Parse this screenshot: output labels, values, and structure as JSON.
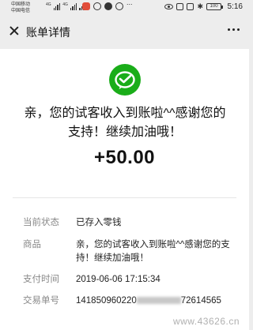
{
  "status_bar": {
    "carrier_1": "中国移动",
    "carrier_2": "中国电信",
    "net_1": "4G",
    "net_2": "4G",
    "battery": "100",
    "time": "5:16"
  },
  "nav": {
    "title": "账单详情"
  },
  "bill": {
    "memo": "亲，您的试客收入到账啦^^感谢您的支持！继续加油哦！",
    "amount": "+50.00",
    "fields": [
      {
        "label": "当前状态",
        "value": "已存入零钱"
      },
      {
        "label": "商品",
        "value": "亲，您的试客收入到账啦^^感谢您的支持！继续加油哦！"
      },
      {
        "label": "支付时间",
        "value": "2019-06-06 17:15:34"
      },
      {
        "label": "交易单号",
        "value_prefix": "141850960220",
        "value_suffix": "72614565"
      }
    ]
  },
  "watermark": "www.43626.cn",
  "colors": {
    "brand_green": "#1aad19",
    "page_bg": "#ededed",
    "label_gray": "#888888"
  },
  "icons": [
    "close-icon",
    "more-icon",
    "wechat-pay-icon",
    "signal-icon",
    "wifi-icon",
    "battery-icon"
  ]
}
